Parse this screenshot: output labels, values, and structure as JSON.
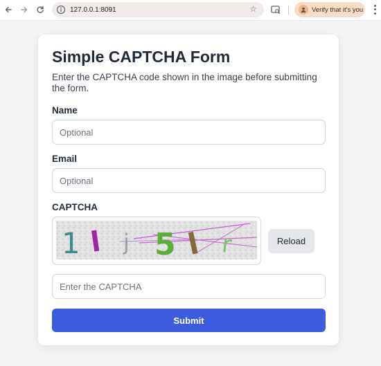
{
  "browser": {
    "url": "127.0.0.1:8091",
    "verify_label": "Verify that it's you",
    "icons": [
      "back-arrow-icon",
      "forward-arrow-icon",
      "reload-icon",
      "site-info-icon",
      "bookmark-star-icon",
      "extension-icon",
      "profile-badge-icon",
      "kebab-menu-icon"
    ]
  },
  "form": {
    "title": "Simple CAPTCHA Form",
    "subtitle": "Enter the CAPTCHA code shown in the image before submitting the form.",
    "name_label": "Name",
    "name_placeholder": "Optional",
    "name_value": "",
    "email_label": "Email",
    "email_placeholder": "Optional",
    "email_value": "",
    "captcha_label": "CAPTCHA",
    "captcha_text": "1lj5lr",
    "reload_label": "Reload",
    "captcha_input_placeholder": "Enter the CAPTCHA",
    "captcha_input_value": "",
    "submit_label": "Submit"
  },
  "colors": {
    "accent": "#3b5ddd",
    "page_bg": "#f3f4f6",
    "card_bg": "#ffffff",
    "input_border": "#c7ddd7",
    "reload_bg": "#e5e7eb",
    "verify_pill_bg": "#f9dcc7"
  }
}
